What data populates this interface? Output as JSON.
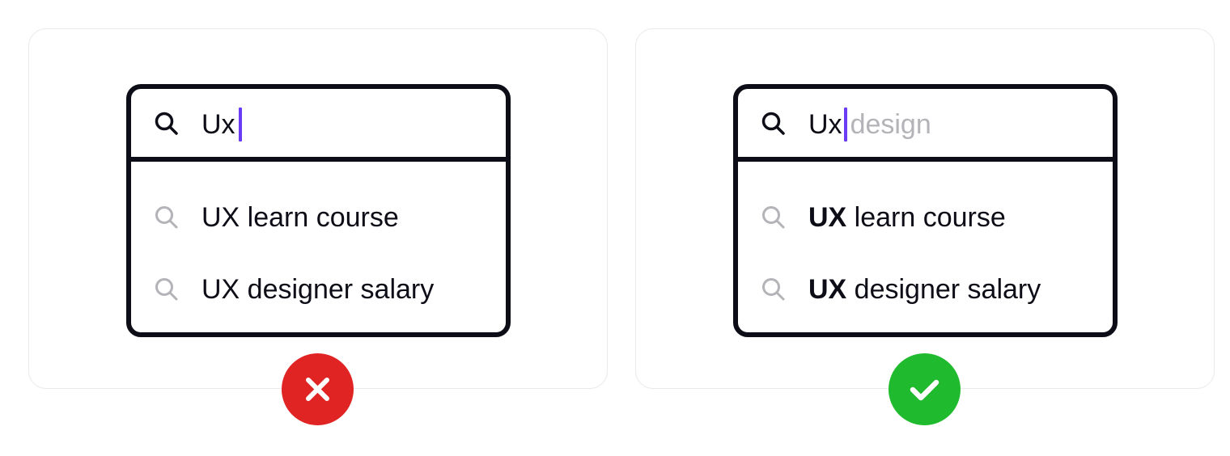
{
  "colors": {
    "frame": "#0d0d17",
    "caret": "#6a3cf5",
    "completion_text": "#b3b3b8",
    "suggestion_icon": "#b3b3b8",
    "panel_border": "#e9e9ee",
    "bad_badge": "#e02424",
    "good_badge": "#1fba2d"
  },
  "left_example": {
    "query_text": "Ux",
    "suggestions": [
      {
        "label": "UX learn course"
      },
      {
        "label": "UX designer salary"
      }
    ],
    "badge_icon": "close-icon"
  },
  "right_example": {
    "query_text": "Ux",
    "completion_text": "design",
    "suggestions": [
      {
        "match": "UX",
        "rest": " learn course"
      },
      {
        "match": "UX",
        "rest": " designer salary"
      }
    ],
    "badge_icon": "checkmark-icon"
  },
  "icons": {
    "search": "search-icon"
  }
}
